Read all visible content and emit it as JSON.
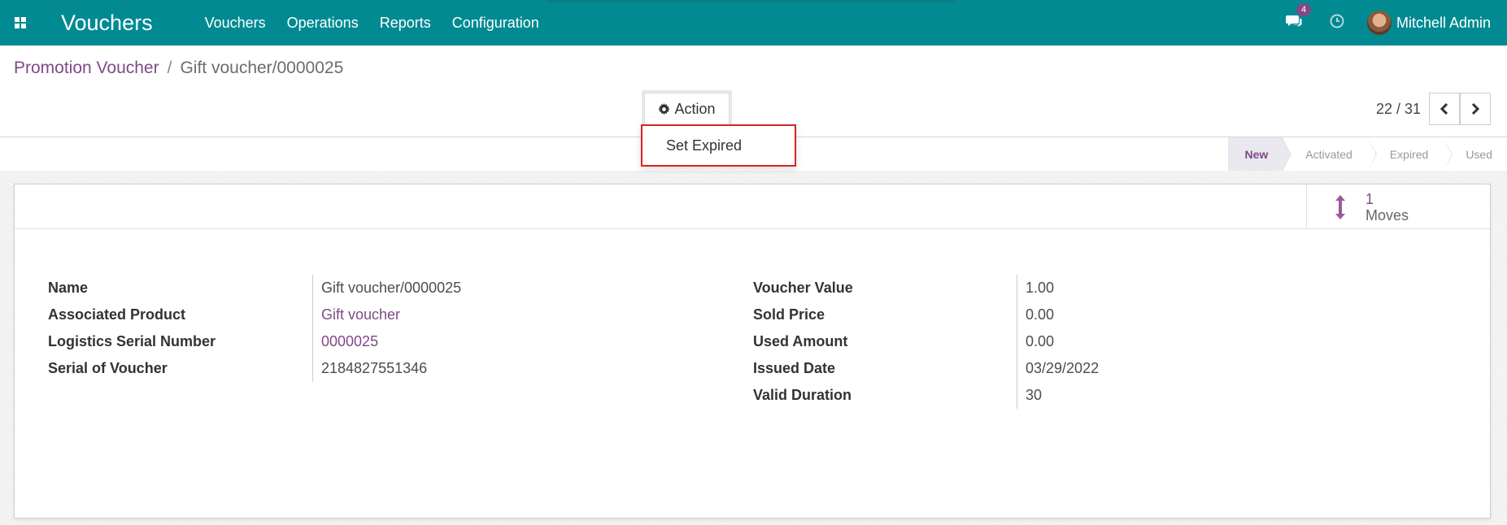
{
  "navbar": {
    "app_title": "Vouchers",
    "menu": [
      "Vouchers",
      "Operations",
      "Reports",
      "Configuration"
    ],
    "notifications_count": "4",
    "user_name": "Mitchell Admin",
    "color": "#018a92"
  },
  "breadcrumb": {
    "parent": "Promotion Voucher",
    "separator": "/",
    "current": "Gift voucher/0000025"
  },
  "toolbar": {
    "action_label": "Action",
    "dropdown_item": "Set Expired"
  },
  "pager": {
    "value": "22 / 31"
  },
  "status": {
    "stages": [
      "New",
      "Activated",
      "Expired",
      "Used"
    ],
    "active": "New"
  },
  "smart_button": {
    "count": "1",
    "label": "Moves"
  },
  "form": {
    "left": [
      {
        "label": "Name",
        "value": "Gift voucher/0000025",
        "link": false
      },
      {
        "label": "Associated Product",
        "value": "Gift voucher",
        "link": true
      },
      {
        "label": "Logistics Serial Number",
        "value": "0000025",
        "link": true
      },
      {
        "label": "Serial of Voucher",
        "value": "2184827551346",
        "link": false
      }
    ],
    "right": [
      {
        "label": "Voucher Value",
        "value": "1.00"
      },
      {
        "label": "Sold Price",
        "value": "0.00"
      },
      {
        "label": "Used Amount",
        "value": "0.00"
      },
      {
        "label": "Issued Date",
        "value": "03/29/2022"
      },
      {
        "label": "Valid Duration",
        "value": "30"
      }
    ]
  },
  "colors": {
    "accent": "#7e4a86",
    "highlight": "#d42525"
  }
}
